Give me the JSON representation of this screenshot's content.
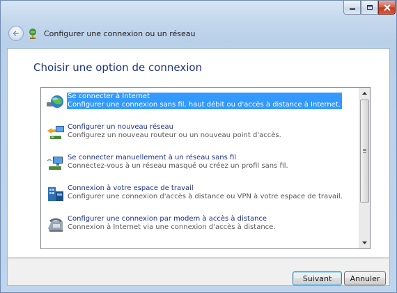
{
  "window": {
    "title": "Configurer une connexion ou un réseau",
    "controls": [
      "minimize",
      "maximize",
      "close"
    ]
  },
  "content": {
    "heading": "Choisir une option de connexion"
  },
  "options": [
    {
      "title": "Se connecter à Internet",
      "description": "Configurer une connexion sans fil, haut débit ou d'accès à distance à Internet.",
      "icon": "globe-connect-icon",
      "selected": true
    },
    {
      "title": "Configurer un nouveau réseau",
      "description": "Configurez un nouveau routeur ou un nouveau point d'accès.",
      "icon": "new-network-icon",
      "selected": false
    },
    {
      "title": "Se connecter manuellement à un réseau sans fil",
      "description": "Connectez-vous à un réseau masqué ou créez un profil sans fil.",
      "icon": "wireless-computer-icon",
      "selected": false
    },
    {
      "title": "Connexion à votre espace de travail",
      "description": "Configurer une connexion d'accès à distance ou VPN à votre espace de travail.",
      "icon": "workplace-building-icon",
      "selected": false
    },
    {
      "title": "Configurer une connexion par modem à accès à distance",
      "description": "Connexion à Internet via une connexion d'accès à distance.",
      "icon": "dialup-modem-icon",
      "selected": false
    }
  ],
  "footer": {
    "next_label": "Suivant",
    "cancel_label": "Annuler"
  },
  "colors": {
    "selection": "#3399ff",
    "heading": "#1e3287",
    "close_button": "#c23a24"
  }
}
